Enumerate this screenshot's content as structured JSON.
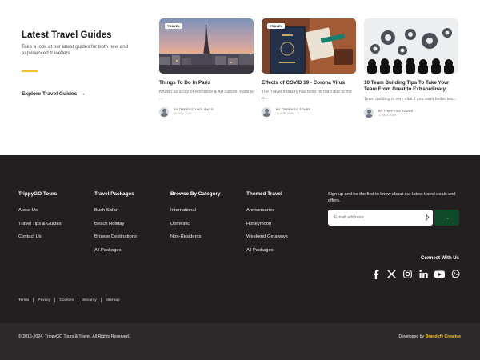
{
  "intro": {
    "title": "Latest Travel Guides",
    "description": "Take a look at our latest guides for both new and experienced travellers",
    "explore_label": "Explore Travel Guides"
  },
  "cards": [
    {
      "tag": "TRAVEL",
      "title": "Things To Do In Paris",
      "excerpt": "Known as a city of Romance & Art culture, Paris is ...",
      "author": "BY TRIPPYGO HOLIDAYS",
      "date": "14 NOV, 2022"
    },
    {
      "tag": "TRAVEL",
      "title": "Effects of COVID 19 - Corona Virus",
      "excerpt": "The Travel Industry has been hit hard due to the p...",
      "author": "BY TRIPPYGO TOURS",
      "date": "14 APR, 2020"
    },
    {
      "tag": "",
      "title": "10 Team Building Tips To Take Your Team From Great to Extraordinary",
      "excerpt": "Team building is very vital if you want better tea...",
      "author": "BY TRIPPYGO TOURS",
      "date": "17 MAY, 2019"
    }
  ],
  "footer": {
    "columns": [
      {
        "heading": "TrippyGO Tours",
        "links": [
          "About Us",
          "Travel Tips & Guides",
          "Contact Us"
        ]
      },
      {
        "heading": "Travel Packages",
        "links": [
          "Bush Safari",
          "Beach Holiday",
          "Browse Destinations",
          "All Packages"
        ]
      },
      {
        "heading": "Browse By Category",
        "links": [
          "International",
          "Domestic",
          "Non-Residents"
        ]
      },
      {
        "heading": "Themed Travel",
        "links": [
          "Anniversaries",
          "Honeymoon",
          "Weekend Getaways",
          "All Packages"
        ]
      }
    ],
    "signup_text": "Sign up and be the first to know about our latest travel deals and offers.",
    "email_placeholder": "Email address",
    "submit_glyph": "→",
    "connect_label": "Connect With Us",
    "socials": [
      "facebook-icon",
      "x-icon",
      "instagram-icon",
      "linkedin-icon",
      "youtube-icon",
      "whatsapp-icon"
    ],
    "legal_links": [
      "Terms",
      "Privacy",
      "Cookies",
      "Security",
      "Sitemap"
    ],
    "copyright": "© 2016-2024, TrippyGO Tours & Travel. All Rights Reserved.",
    "developed_by": "Developed by",
    "developer": "Brandefy Creative"
  },
  "colors": {
    "footer_bg": "#231f20",
    "bottom_bar_bg": "#2e2a2b",
    "accent_yellow": "#f2c12e",
    "submit_green": "#0f4a2a"
  }
}
